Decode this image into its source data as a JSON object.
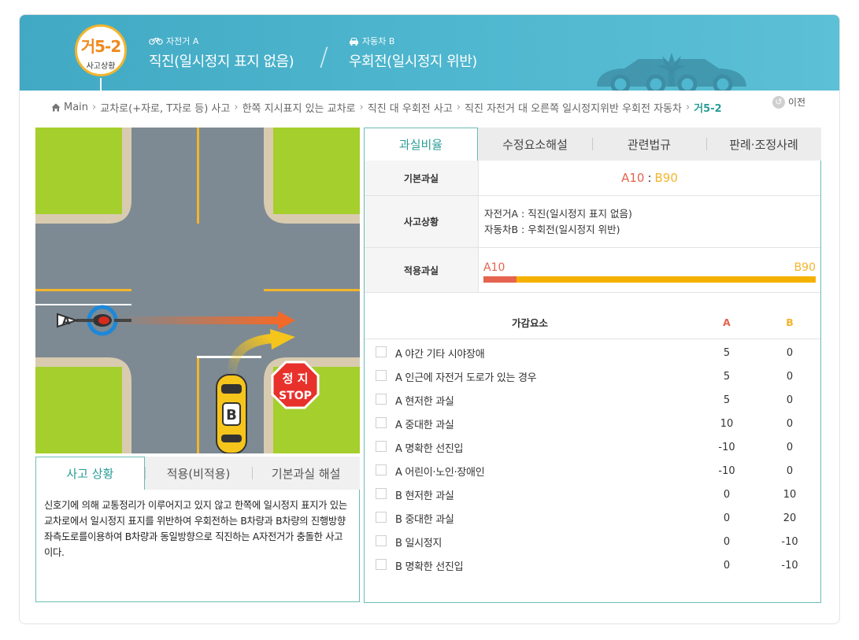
{
  "case": {
    "code": "거5-2",
    "subtitle": "사고상황"
  },
  "party_a": {
    "label": "자전거 A",
    "title": "직진(일시정지 표지 없음)"
  },
  "party_b": {
    "label": "자동차 B",
    "title": "우회전(일시정지 위반)"
  },
  "breadcrumb": [
    "Main",
    "교차로(+자로, T자로 등) 사고",
    "한쪽 지시표지 있는 교차로",
    "직진 대 우회전 사고",
    "직진 자전거 대 오른쪽 일시정지위반 우회전 자동차",
    "거5-2"
  ],
  "prev_label": "이전",
  "scene": {
    "label_a": "A",
    "label_b": "B",
    "sign_ko": "정 지",
    "sign_en": "STOP"
  },
  "info_tabs": [
    "사고 상황",
    "적용(비적용)",
    "기본과실 해설"
  ],
  "info_text": "신호기에 의해 교통정리가 이루어지고 있지 않고 한쪽에 일시정지 표지가 있는교차로에서 일시정지 표지를 위반하여 우회전하는 B차량과 B차량의 진행방향 좌측도로를이용하여 B차량과 동일방향으로 직진하는 A자전거가 충돌한 사고이다.",
  "right_tabs": [
    "과실비율",
    "수정요소해설",
    "관련법규",
    "판례·조정사례"
  ],
  "base_fault": {
    "label": "기본과실",
    "a": "A10",
    "b": "B90"
  },
  "situation": {
    "label": "사고상황",
    "line1": "자전거A : 직진(일시정지 표지 없음)",
    "line2": "자동차B : 우회전(일시정지 위반)"
  },
  "applied": {
    "label": "적용과실",
    "a": "A10",
    "b": "B90",
    "a_percent": 10
  },
  "factors_header": {
    "name": "가감요소",
    "a": "A",
    "b": "B"
  },
  "factors": [
    {
      "name": "A 야간 기타 시야장애",
      "a": "5",
      "b": "0"
    },
    {
      "name": "A 인근에 자전거 도로가 있는 경우",
      "a": "5",
      "b": "0"
    },
    {
      "name": "A 현저한 과실",
      "a": "5",
      "b": "0"
    },
    {
      "name": "A 중대한 과실",
      "a": "10",
      "b": "0"
    },
    {
      "name": "A 명확한 선진입",
      "a": "-10",
      "b": "0"
    },
    {
      "name": "A 어린이·노인·장애인",
      "a": "-10",
      "b": "0"
    },
    {
      "name": "B 현저한 과실",
      "a": "0",
      "b": "10"
    },
    {
      "name": "B 중대한 과실",
      "a": "0",
      "b": "20"
    },
    {
      "name": "B 일시정지",
      "a": "0",
      "b": "-10"
    },
    {
      "name": "B 명확한 선진입",
      "a": "0",
      "b": "-10"
    }
  ],
  "colors": {
    "accent": "#2a9c96",
    "banner": "#4fb7cf",
    "party_a": "#e5634f",
    "party_b": "#f2b52d"
  }
}
